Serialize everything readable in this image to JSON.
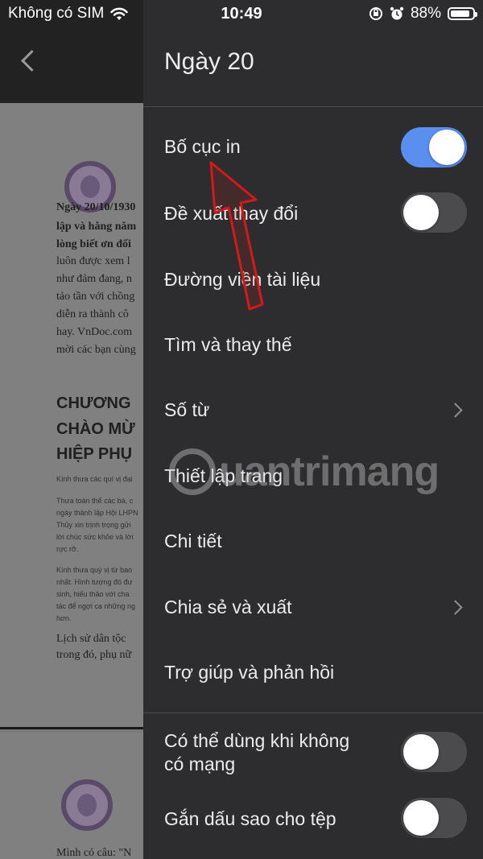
{
  "status_bar": {
    "carrier": "Không có SIM",
    "time": "10:49",
    "battery": "88%",
    "battery_level": 0.88
  },
  "document": {
    "paragraph_lines": [
      "Ngày 20/10/1930",
      "lập và hằng năm",
      "lòng biết ơn đối",
      "luôn được xem l",
      "như đảm đang, n",
      "tảo tần với chồng",
      "diễn ra thành cô",
      "hay. VnDoc.com",
      "mời các bạn cùng"
    ],
    "heading_lines": [
      "CHƯƠNG",
      "CHÀO MỪ",
      "HIỆP PHỤ"
    ],
    "small_lines_1": [
      "Kính thưa các quí vị đại"
    ],
    "small_lines_2": [
      "Thưa toàn thể các bà, c",
      "ngày thành lập Hội LHPN",
      "Thủy xin trịnh trọng gửi",
      "lời chúc sức khỏe và lời",
      "rực rỡ."
    ],
    "small_lines_3": [
      "Kính thưa quý vị từ bao",
      "nhất. Hình tượng đó đư",
      "sinh, hiếu thảo với cha",
      "tác để ngợi ca những ng",
      "hơn."
    ],
    "paragraph2_lines": [
      "Lịch sử dân tộc",
      "trong đó, phụ nữ"
    ],
    "page2_line": "Mình có câu: \"N"
  },
  "menu": {
    "title": "Ngày 20",
    "items": [
      {
        "label": "Bố cục in",
        "control": "toggle",
        "on": true
      },
      {
        "label": "Đề xuất thay đổi",
        "control": "toggle",
        "on": false
      },
      {
        "label": "Đường viền tài liệu",
        "control": "none"
      },
      {
        "label": "Tìm và thay thế",
        "control": "none"
      },
      {
        "label": "Số từ",
        "control": "chevron"
      },
      {
        "label": "Thiết lập trang",
        "control": "none"
      },
      {
        "label": "Chi tiết",
        "control": "none"
      },
      {
        "label": "Chia sẻ và xuất",
        "control": "chevron"
      },
      {
        "label": "Trợ giúp và phản hồi",
        "control": "none"
      }
    ],
    "offline_items": [
      {
        "label_line1": "Có thể dùng khi không",
        "label_line2": "có mạng",
        "control": "toggle",
        "on": false
      },
      {
        "label": "Gắn dấu sao cho tệp",
        "control": "toggle",
        "on": false
      }
    ]
  },
  "watermark": {
    "text": "uantrimang",
    "icon": "quantrimang-logo-icon"
  },
  "colors": {
    "menu_bg": "#2d2d2f",
    "toggle_on": "#5a8ff0",
    "toggle_off": "#4b4b4e",
    "arrow": "#d11a1a"
  }
}
